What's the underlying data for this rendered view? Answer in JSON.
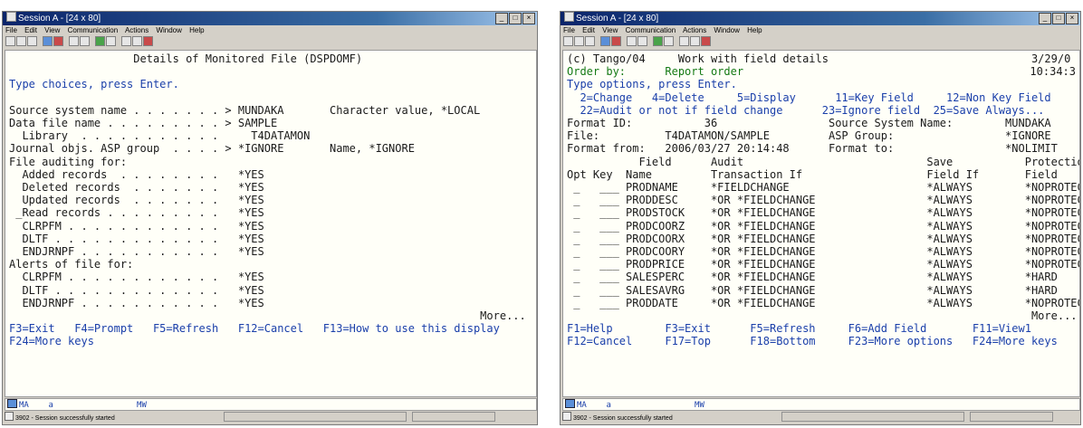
{
  "left": {
    "title": "Session A - [24 x 80]",
    "menu": [
      "File",
      "Edit",
      "View",
      "Communication",
      "Actions",
      "Window",
      "Help"
    ],
    "lines": [
      {
        "t": "                   Details of Monitored File (DSPDOMF)",
        "c": ""
      },
      {
        "t": "",
        "c": ""
      },
      {
        "t": "Type choices, press Enter.",
        "c": "bl"
      },
      {
        "t": "",
        "c": ""
      },
      {
        "t": "Source system name . . . . . . . > MUNDAKA       Character value, *LOCAL",
        "c": ""
      },
      {
        "t": "Data file name . . . . . . . . . > SAMPLE",
        "c": ""
      },
      {
        "t": "  Library  . . . . . . . . . . .     T4DATAMON",
        "c": ""
      },
      {
        "t": "Journal objs. ASP group  . . . . > *IGNORE       Name, *IGNORE",
        "c": ""
      },
      {
        "t": "File auditing for:",
        "c": ""
      },
      {
        "t": "  Added records  . . . . . . . .   *YES",
        "c": ""
      },
      {
        "t": "  Deleted records  . . . . . . .   *YES",
        "c": ""
      },
      {
        "t": "  Updated records  . . . . . . .   *YES",
        "c": ""
      },
      {
        "t": " _Read records . . . . . . . . .   *YES",
        "c": ""
      },
      {
        "t": "  CLRPFM . . . . . . . . . . . .   *YES",
        "c": ""
      },
      {
        "t": "  DLTF . . . . . . . . . . . . .   *YES",
        "c": ""
      },
      {
        "t": "  ENDJRNPF . . . . . . . . . . .   *YES",
        "c": ""
      },
      {
        "t": "Alerts of file for:",
        "c": ""
      },
      {
        "t": "  CLRPFM . . . . . . . . . . . .   *YES",
        "c": ""
      },
      {
        "t": "  DLTF . . . . . . . . . . . . .   *YES",
        "c": ""
      },
      {
        "t": "  ENDJRNPF . . . . . . . . . . .   *YES",
        "c": ""
      },
      {
        "t": "                                                                        More...",
        "c": ""
      },
      {
        "t": "F3=Exit   F4=Prompt   F5=Refresh   F12=Cancel   F13=How to use this display",
        "c": "bl"
      },
      {
        "t": "F24=More keys",
        "c": "bl"
      }
    ],
    "oia": "MA    a                 MW",
    "status": "3902 - Session successfully started"
  },
  "right": {
    "title": "Session A - [24 x 80]",
    "menu": [
      "File",
      "Edit",
      "View",
      "Communication",
      "Actions",
      "Window",
      "Help"
    ],
    "lines": [
      {
        "t": "(c) Tango/04     Work with field details                               3/29/0",
        "c": ""
      },
      {
        "t": "Order by:      Report order",
        "c": "hi"
      },
      {
        "t": "Type options, press Enter.",
        "c": "bl"
      },
      {
        "t": "  2=Change   4=Delete     5=Display      11=Key Field     12=Non Key Field",
        "c": "bl"
      },
      {
        "t": "  22=Audit or not if field change      23=Ignore field  25=Save Always...",
        "c": "bl"
      },
      {
        "t": "Format ID:           36                 Source System Name:        MUNDAKA",
        "c": ""
      },
      {
        "t": "File:          T4DATAMON/SAMPLE         ASP Group:                 *IGNORE",
        "c": ""
      },
      {
        "t": "Format from:   2006/03/27 20:14:48      Format to:                 *NOLIMIT",
        "c": ""
      },
      {
        "t": "           Field      Audit                            Save           Protectio",
        "c": ""
      },
      {
        "t": "Opt Key  Name         Transaction If                   Field If       Field",
        "c": ""
      },
      {
        "t": " _   ___ PRODNAME     *FIELDCHANGE                     *ALWAYS        *NOPROTEC",
        "c": ""
      },
      {
        "t": " _   ___ PRODDESC     *OR *FIELDCHANGE                 *ALWAYS        *NOPROTEC",
        "c": ""
      },
      {
        "t": " _   ___ PRODSTOCK    *OR *FIELDCHANGE                 *ALWAYS        *NOPROTEC",
        "c": ""
      },
      {
        "t": " _   ___ PRODCOORZ    *OR *FIELDCHANGE                 *ALWAYS        *NOPROTEC",
        "c": ""
      },
      {
        "t": " _   ___ PRODCOORX    *OR *FIELDCHANGE                 *ALWAYS        *NOPROTEC",
        "c": ""
      },
      {
        "t": " _   ___ PRODCOORY    *OR *FIELDCHANGE                 *ALWAYS        *NOPROTEC",
        "c": ""
      },
      {
        "t": " _   ___ PRODPRICE    *OR *FIELDCHANGE                 *ALWAYS        *NOPROTEC",
        "c": ""
      },
      {
        "t": " _   ___ SALESPERC    *OR *FIELDCHANGE                 *ALWAYS        *HARD",
        "c": ""
      },
      {
        "t": " _   ___ SALESAVRG    *OR *FIELDCHANGE                 *ALWAYS        *HARD",
        "c": ""
      },
      {
        "t": " _   ___ PRODDATE     *OR *FIELDCHANGE                 *ALWAYS        *NOPROTEC",
        "c": ""
      },
      {
        "t": "                                                                       More...",
        "c": ""
      },
      {
        "t": "F1=Help        F3=Exit      F5=Refresh     F6=Add Field       F11=View1",
        "c": "bl"
      },
      {
        "t": "F12=Cancel     F17=Top      F18=Bottom     F23=More options   F24=More keys",
        "c": "bl"
      }
    ],
    "time": "10:34:3",
    "oia": "MA    a                 MW",
    "status": "3902 - Session successfully started"
  }
}
